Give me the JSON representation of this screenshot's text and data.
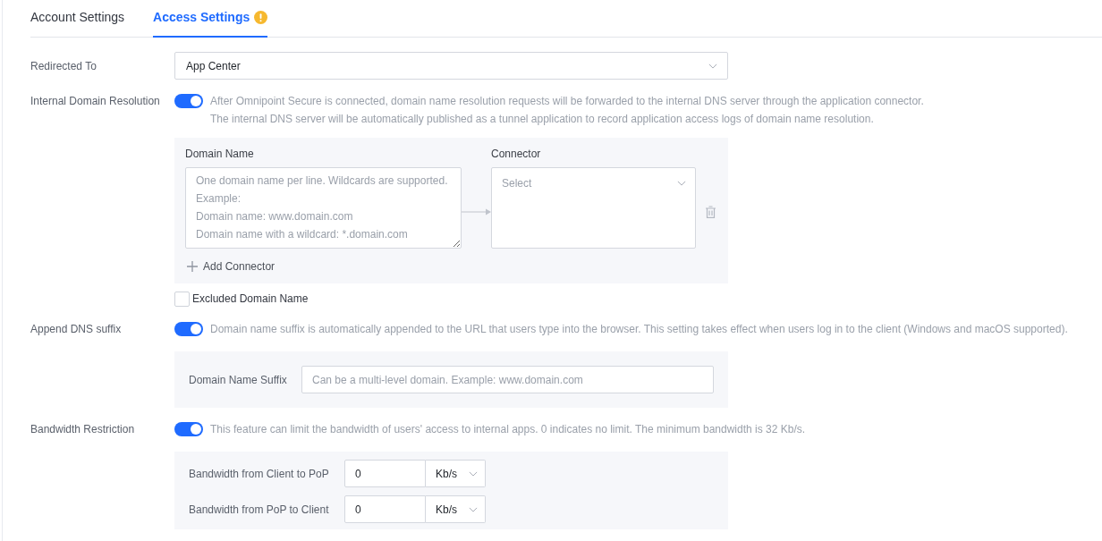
{
  "tabs": [
    {
      "label": "Account Settings",
      "selected": false,
      "warning": false
    },
    {
      "label": "Access Settings",
      "selected": true,
      "warning": true
    }
  ],
  "redirected_to": {
    "label": "Redirected To",
    "value": "App Center"
  },
  "internal_domain_resolution": {
    "label": "Internal Domain Resolution",
    "on": true,
    "description": [
      "After Omnipoint Secure is connected, domain name resolution requests will be forwarded to the internal DNS server through the application connector.",
      "The internal DNS server will be automatically published as a tunnel application to record application access logs of domain name resolution."
    ],
    "domain_name": {
      "label": "Domain Name",
      "placeholder": "One domain name per line. Wildcards are supported.\nExample:\nDomain name: www.domain.com\nDomain name with a wildcard: *.domain.com"
    },
    "connector": {
      "label": "Connector",
      "placeholder": "Select"
    },
    "add_connector": "Add Connector",
    "excluded_domain_name": {
      "label": "Excluded Domain Name",
      "checked": false
    }
  },
  "append_dns_suffix": {
    "label": "Append DNS suffix",
    "on": true,
    "description": "Domain name suffix is automatically appended to the URL that users type into the browser. This setting takes effect when users log in to the client (Windows and macOS supported).",
    "domain_name_suffix": {
      "label": "Domain Name Suffix",
      "placeholder": "Can be a multi-level domain. Example: www.domain.com"
    }
  },
  "bandwidth_restriction": {
    "label": "Bandwidth Restriction",
    "on": true,
    "description": "This feature can limit the bandwidth of users' access to internal apps. 0 indicates no limit. The minimum bandwidth is 32 Kb/s.",
    "limits": [
      {
        "label": "Bandwidth from Client to PoP",
        "value": "0",
        "unit": "Kb/s"
      },
      {
        "label": "Bandwidth from PoP to Client",
        "value": "0",
        "unit": "Kb/s"
      }
    ]
  }
}
